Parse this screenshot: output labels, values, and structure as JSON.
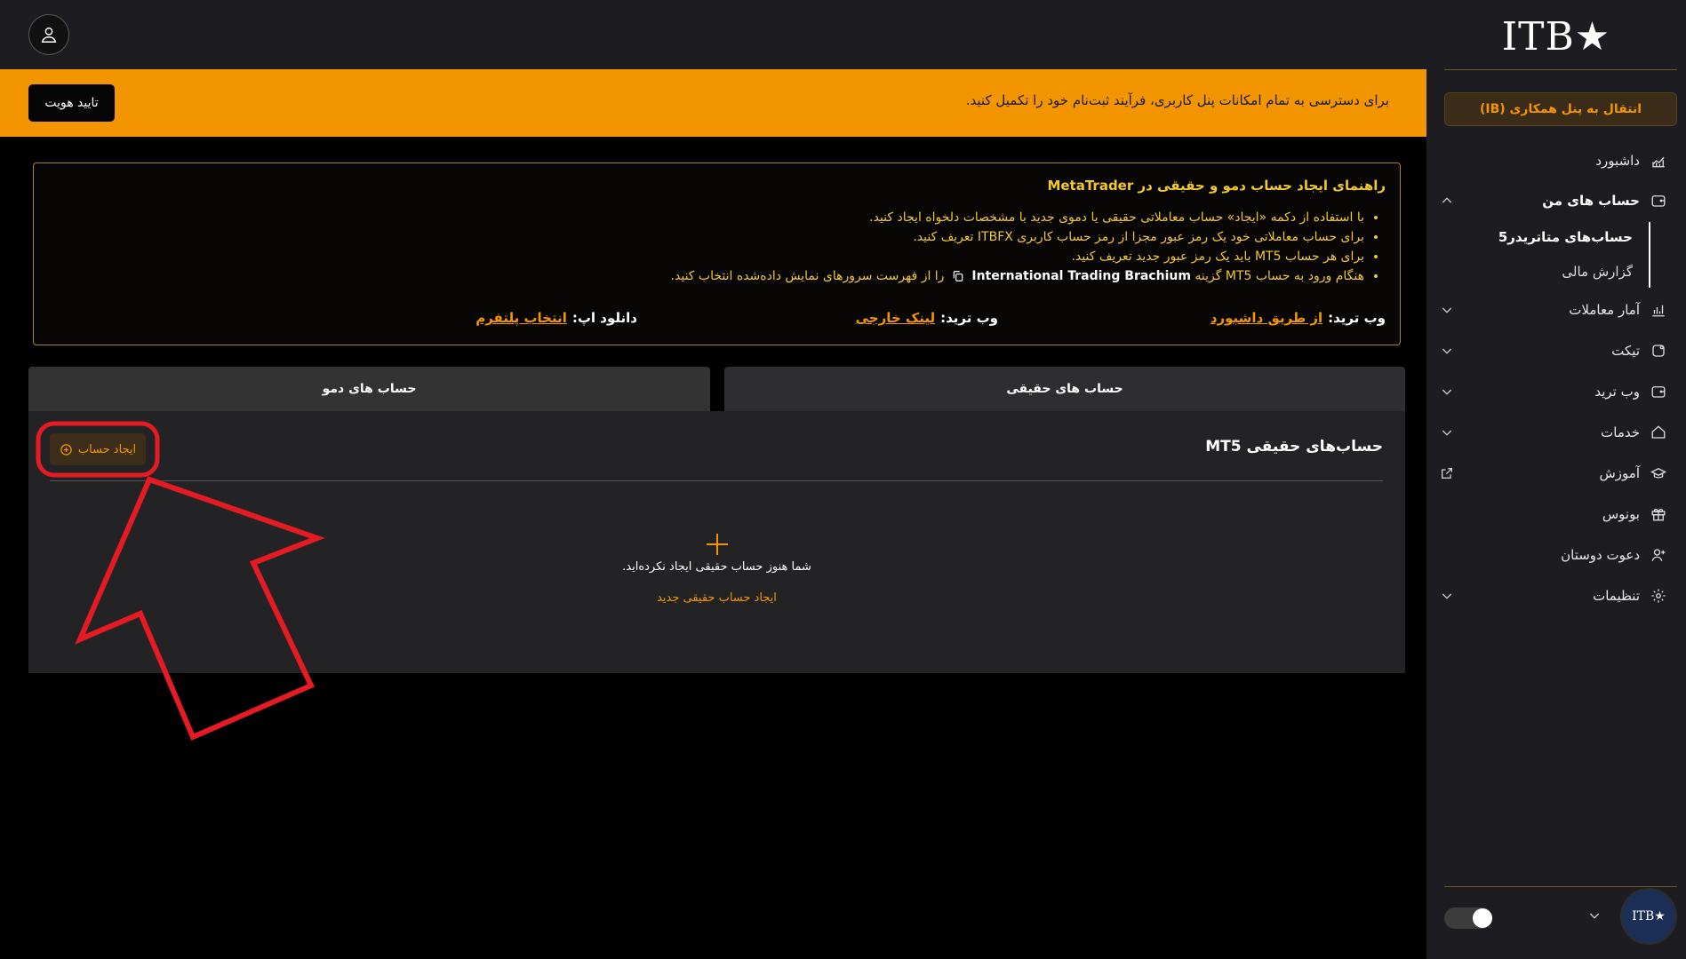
{
  "sidebar": {
    "logo": "ITB★",
    "ib_button": "انتقال به پنل همکاری (IB)",
    "nav": [
      {
        "label": "داشبورد",
        "icon": "chart-trend-icon"
      },
      {
        "label": "حساب های من",
        "icon": "wallet-icon",
        "chevron": "chevron-up-icon"
      },
      {
        "label": "آمار معاملات",
        "icon": "bar-chart-icon",
        "chevron": "chevron-down-icon"
      },
      {
        "label": "تیکت",
        "icon": "ticket-icon",
        "chevron": "chevron-down-icon"
      },
      {
        "label": "وب ترید",
        "icon": "wallet-icon",
        "chevron": "chevron-down-icon"
      },
      {
        "label": "خدمات",
        "icon": "home-icon",
        "chevron": "chevron-down-icon"
      },
      {
        "label": "آموزش",
        "icon": "graduation-cap-icon",
        "chevron": "external-link-icon"
      },
      {
        "label": "بونوس",
        "icon": "gift-icon"
      },
      {
        "label": "دعوت دوستان",
        "icon": "user-plus-icon"
      },
      {
        "label": "تنظیمات",
        "icon": "gear-icon",
        "chevron": "chevron-down-icon"
      }
    ],
    "sub_items": [
      "حساب‌های متاتریدر5",
      "گزارش مالی"
    ],
    "brand_badge": "ITB★"
  },
  "banner": {
    "text": "برای دسترسی به تمام امکانات پنل کاربری، فرآیند ثبت‌نام خود را تکمیل کنید.",
    "verify_button": "تایید هویت"
  },
  "guide": {
    "title": "راهنمای ایجاد حساب دمو و حقیقی در MetaTrader",
    "bullets": [
      "با استفاده از دکمه «ایجاد» حساب معاملاتی حقیقی یا دموی جدید با مشخصات دلخواه ایجاد کنید.",
      "برای حساب معاملاتی خود یک رمز عبور مجزا از رمز حساب کاربری ITBFX تعریف کنید.",
      "برای هر حساب MT5 باید یک رمز عبور جدید تعریف کنید."
    ],
    "bullet4_pre": "هنگام ورود به حساب MT5 گزینه",
    "bullet4_server": "International Trading Brachium",
    "bullet4_post": "را از فهرست سرورهای نمایش داده‌شده انتخاب کنید.",
    "links": [
      {
        "label": "وب ترید:",
        "link": "از طریق داشبورد"
      },
      {
        "label": "وب ترید:",
        "link": "لینک خارجی"
      },
      {
        "label": "دانلود اپ:",
        "link": "انتخاب پلتفرم"
      }
    ]
  },
  "tabs": {
    "real": "حساب های حقیقی",
    "demo": "حساب های دمو"
  },
  "panel": {
    "title": "حساب‌های حقیقی MT5",
    "create_button": "ایجاد حساب",
    "empty_text": "شما هنوز حساب حقیقی ایجاد نکرده‌اید.",
    "empty_link": "ایجاد حساب حقیقی جدید"
  },
  "colors": {
    "accent": "#f39500",
    "guide_text": "#f2c830",
    "annotation": "#e51b24"
  }
}
